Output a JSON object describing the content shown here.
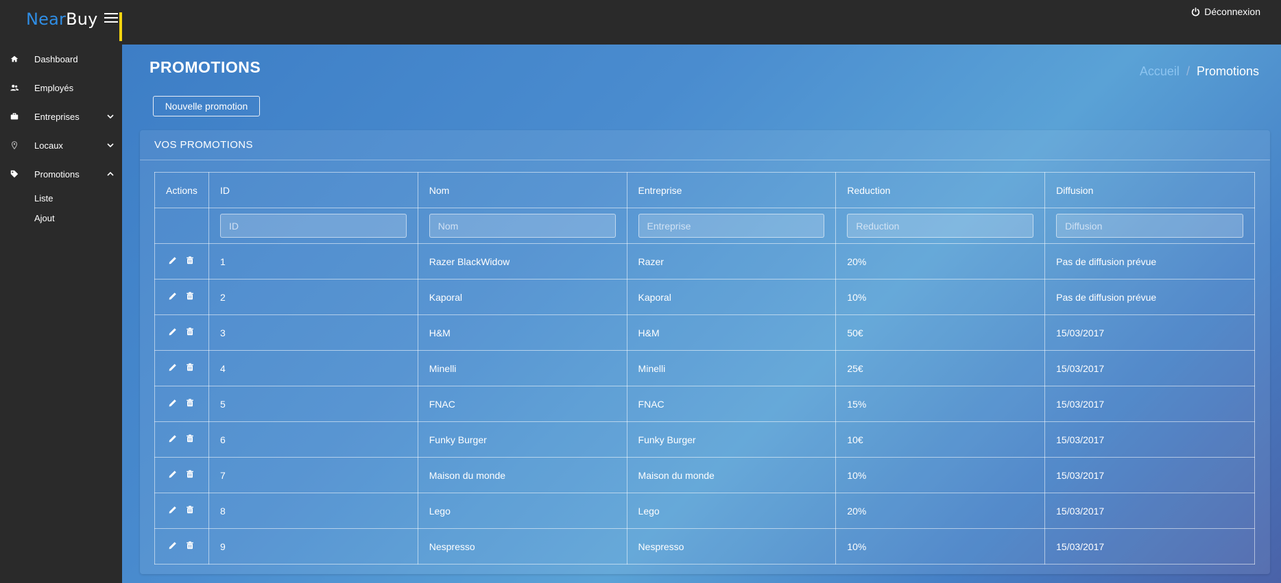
{
  "brand": {
    "part1": "Near",
    "part2": "Buy"
  },
  "header": {
    "logout_label": "Déconnexion"
  },
  "sidebar": {
    "items": [
      {
        "label": "Dashboard",
        "icon": "home-icon"
      },
      {
        "label": "Employés",
        "icon": "users-icon"
      },
      {
        "label": "Entreprises",
        "icon": "briefcase-icon",
        "expandable": true
      },
      {
        "label": "Locaux",
        "icon": "map-pin-icon",
        "expandable": true
      },
      {
        "label": "Promotions",
        "icon": "tag-icon",
        "expanded": true
      }
    ],
    "sub_items": [
      "Liste",
      "Ajout"
    ]
  },
  "page": {
    "title": "PROMOTIONS",
    "breadcrumb": {
      "home": "Accueil",
      "separator": "/",
      "current": "Promotions"
    },
    "new_button": "Nouvelle promotion"
  },
  "panel": {
    "title": "VOS PROMOTIONS"
  },
  "table": {
    "columns": [
      "Actions",
      "ID",
      "Nom",
      "Entreprise",
      "Reduction",
      "Diffusion"
    ],
    "filters": [
      "ID",
      "Nom",
      "Entreprise",
      "Reduction",
      "Diffusion"
    ],
    "rows": [
      {
        "id": "1",
        "nom": "Razer BlackWidow",
        "entreprise": "Razer",
        "reduction": "20%",
        "diffusion": "Pas de diffusion prévue"
      },
      {
        "id": "2",
        "nom": "Kaporal",
        "entreprise": "Kaporal",
        "reduction": "10%",
        "diffusion": "Pas de diffusion prévue"
      },
      {
        "id": "3",
        "nom": "H&M",
        "entreprise": "H&M",
        "reduction": "50€",
        "diffusion": "15/03/2017"
      },
      {
        "id": "4",
        "nom": "Minelli",
        "entreprise": "Minelli",
        "reduction": "25€",
        "diffusion": "15/03/2017"
      },
      {
        "id": "5",
        "nom": "FNAC",
        "entreprise": "FNAC",
        "reduction": "15%",
        "diffusion": "15/03/2017"
      },
      {
        "id": "6",
        "nom": "Funky Burger",
        "entreprise": "Funky Burger",
        "reduction": "10€",
        "diffusion": "15/03/2017"
      },
      {
        "id": "7",
        "nom": "Maison du monde",
        "entreprise": "Maison du monde",
        "reduction": "10%",
        "diffusion": "15/03/2017"
      },
      {
        "id": "8",
        "nom": "Lego",
        "entreprise": "Lego",
        "reduction": "20%",
        "diffusion": "15/03/2017"
      },
      {
        "id": "9",
        "nom": "Nespresso",
        "entreprise": "Nespresso",
        "reduction": "10%",
        "diffusion": "15/03/2017"
      }
    ]
  },
  "colors": {
    "brand_blue": "#2f8de4",
    "accent_yellow": "#f5d410",
    "sidebar_bg": "#2a2a2a"
  }
}
